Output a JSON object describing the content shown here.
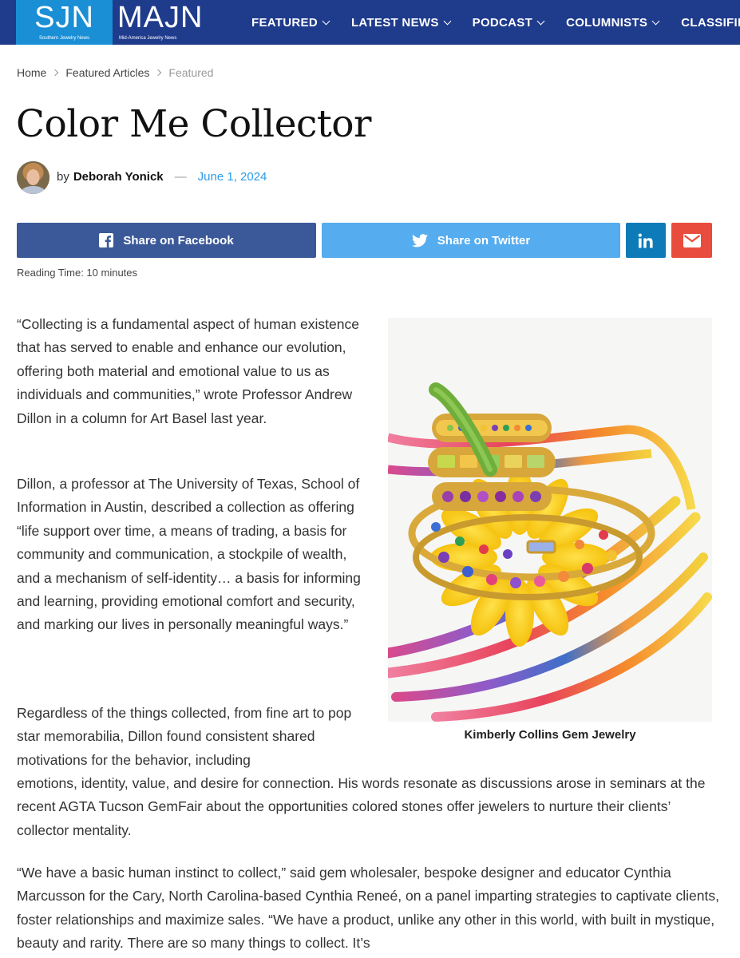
{
  "header": {
    "logo_sjn": "SJN",
    "logo_sjn_sub": "Southern Jewelry News",
    "logo_majn": "MAJN",
    "logo_majn_sub": "Mid-America Jewelry News",
    "nav": [
      {
        "label": "FEATURED"
      },
      {
        "label": "LATEST NEWS"
      },
      {
        "label": "PODCAST"
      },
      {
        "label": "COLUMNISTS"
      },
      {
        "label": "CLASSIFIED"
      }
    ],
    "bg_color": "#1f3b8c",
    "sjn_color": "#1a8fd6"
  },
  "breadcrumb": [
    "Home",
    "Featured Articles",
    "Featured"
  ],
  "article": {
    "title": "Color Me Collector",
    "by": "by",
    "author": "Deborah Yonick",
    "dash": "—",
    "date": "June 1, 2024",
    "reading_time": "Reading Time: 10 minutes",
    "paragraphs": [
      "“Collecting is a fundamental aspect of human existence that has served to enable and enhance our evolution, offering both material and emotional value to us as individuals and communities,” wrote Professor Andrew Dillon in a column for Art Basel last year.",
      "Dillon, a professor at The University of Texas, School of Information in Austin, described a collection as offering “life support over time, a means of trading, a basis for community and communication, a stockpile of wealth, and a mechanism of self-identity… a basis for informing and learning, providing emotional comfort and security, and marking our lives in personally meaningful ways.”",
      "Regardless of the things collected, from fine art to pop star memorabilia, Dillon found consistent shared motivations for the behavior, including",
      "emotions, identity, value, and desire for connection. His words resonate as discussions arose in seminars at the recent AGTA Tucson GemFair about the opportunities colored stones offer jewelers to nurture their clients’ collector mentality.",
      "“We have a basic human instinct to collect,” said gem wholesaler, bespoke designer and educator Cynthia Marcusson for the Cary, North Carolina-based Cynthia Reneé, on a panel imparting strategies to captivate clients, foster relationships and maximize sales. “We have a product, unlike any other in this world, with built in mystique, beauty and rarity. There are so many things to collect. It’s"
    ],
    "image_caption": "Kimberly Collins Gem Jewelry"
  },
  "share": {
    "facebook": "Share on Facebook",
    "twitter": "Share on Twitter",
    "facebook_color": "#3b5998",
    "twitter_color": "#55acee",
    "linkedin_color": "#0d7bb8",
    "email_color": "#e84c3d",
    "icons": [
      "facebook-icon",
      "twitter-icon",
      "linkedin-icon",
      "email-icon"
    ]
  }
}
